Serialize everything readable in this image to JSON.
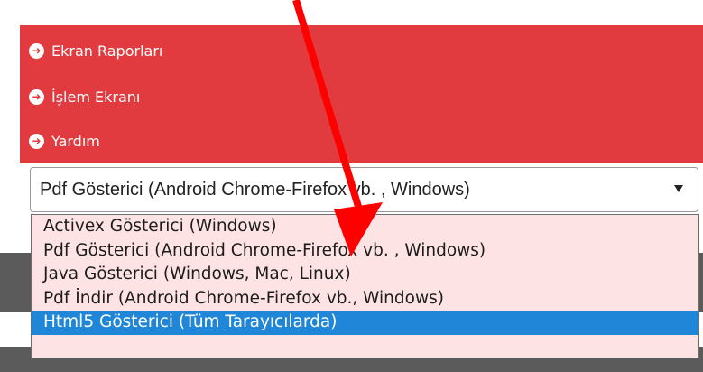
{
  "menu": {
    "items": [
      {
        "label": "Ekran Raporları",
        "icon": "arrow-right-circle-icon"
      },
      {
        "label": "İşlem Ekranı",
        "icon": "arrow-right-circle-icon"
      },
      {
        "label": "Yardım",
        "icon": "arrow-right-circle-icon"
      }
    ],
    "background_color": "#e23b3f"
  },
  "viewer_select": {
    "selected": "Pdf Gösterici (Android Chrome-Firefox vb. , Windows)",
    "options": [
      "Activex Gösterici (Windows)",
      "Pdf Gösterici (Android Chrome-Firefox vb. , Windows)",
      "Java Gösterici (Windows, Mac, Linux)",
      "Pdf İndir (Android Chrome-Firefox vb., Windows)",
      "Html5 Gösterici (Tüm Tarayıcılarda)"
    ],
    "highlighted_option": "Html5 Gösterici (Tüm Tarayıcılarda)",
    "highlight_color": "#1f86d8",
    "dropdown_background": "#fde3e3"
  },
  "annotation": {
    "arrow_color": "#ff0000",
    "points_to": "Pdf Gösterici (Android Chrome-Firefox vb. , Windows)"
  }
}
